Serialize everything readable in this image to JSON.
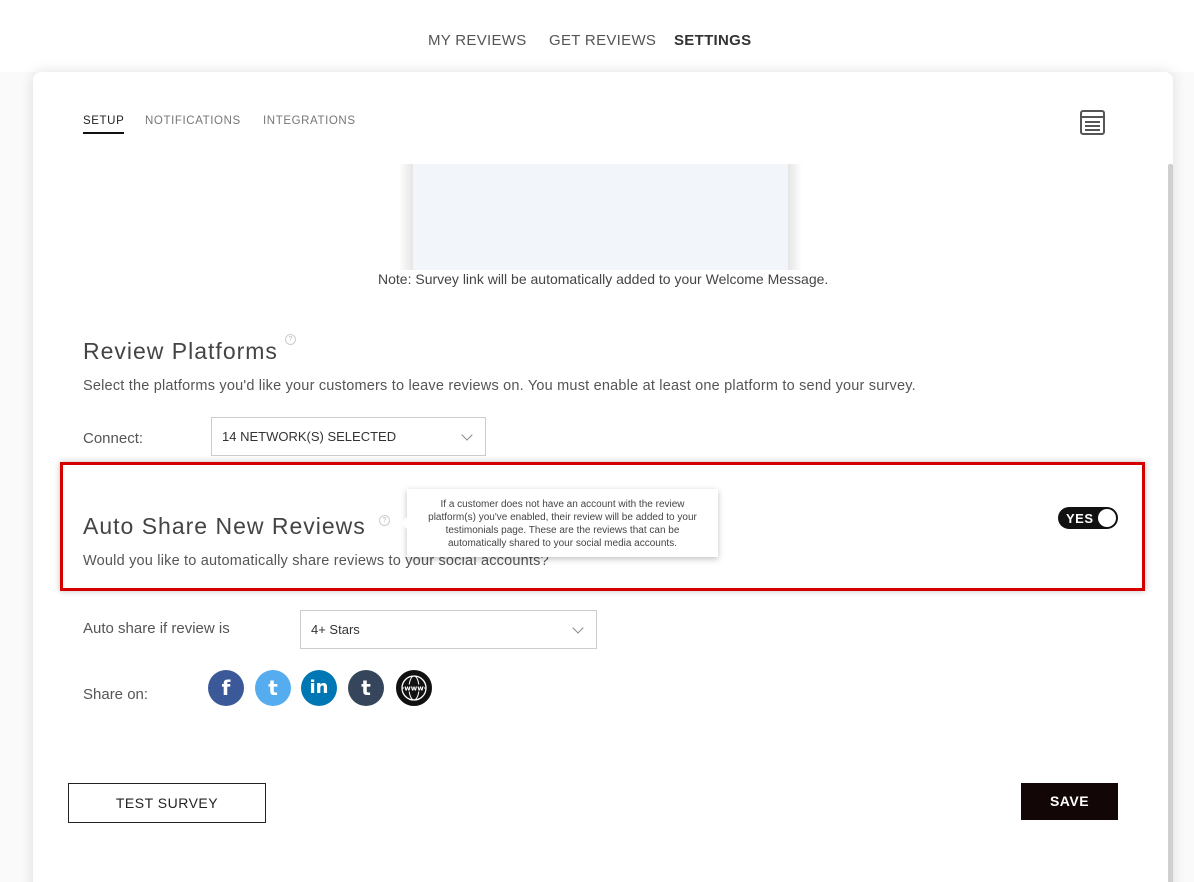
{
  "topnav": {
    "my_reviews": "MY REVIEWS",
    "get_reviews": "GET REVIEWS",
    "settings": "SETTINGS"
  },
  "subtabs": {
    "setup": "SETUP",
    "notifications": "NOTIFICATIONS",
    "integrations": "INTEGRATIONS"
  },
  "preview": {
    "note": "Note: Survey link will be automatically added to your Welcome Message."
  },
  "review_platforms": {
    "title": "Review Platforms",
    "help": "?",
    "description": "Select the platforms you'd like your customers to leave reviews on. You must enable at least one platform to send your survey.",
    "connect_label": "Connect:",
    "connect_value": "14 NETWORK(S) SELECTED"
  },
  "auto_share": {
    "title": "Auto Share New Reviews",
    "help": "?",
    "description": "Would you like to automatically share reviews to your social accounts?",
    "tooltip": "If a customer does not have an account with the review platform(s) you've enabled, their review will be added to your testimonials page. These are the reviews that can be automatically shared to your social media accounts.",
    "toggle_label": "YES",
    "toggle_on": true,
    "if_review_label": "Auto share if review is",
    "if_review_value": "4+ Stars",
    "share_on_label": "Share on:",
    "networks": [
      {
        "name": "facebook-icon",
        "glyph": "f",
        "color": "#3b5998"
      },
      {
        "name": "twitter-icon",
        "glyph": "t",
        "color": "#55acee"
      },
      {
        "name": "linkedin-icon",
        "glyph": "in",
        "color": "#0077b5"
      },
      {
        "name": "tumblr-icon",
        "glyph": "t",
        "color": "#35465c"
      },
      {
        "name": "website-icon",
        "glyph": "www",
        "color": "#111111"
      }
    ]
  },
  "buttons": {
    "test_survey": "TEST SURVEY",
    "save": "SAVE"
  },
  "colors": {
    "highlight_border": "#d40000",
    "save_bg": "#130606",
    "toggle_bg": "#111111"
  }
}
